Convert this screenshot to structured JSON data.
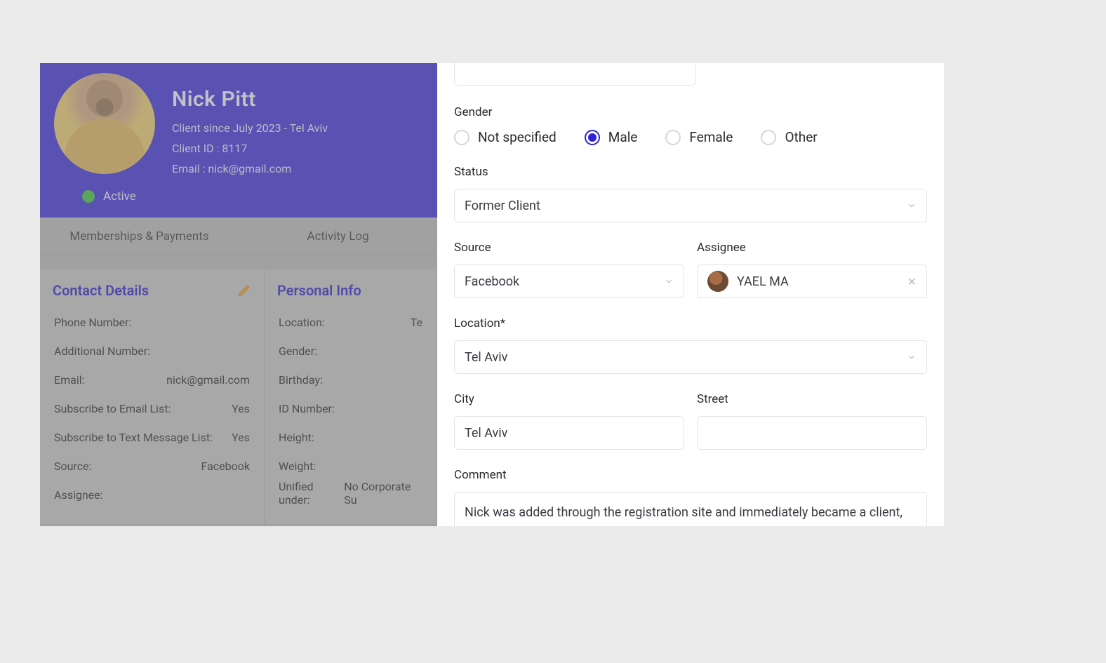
{
  "header": {
    "name": "Nick Pitt",
    "since_line": "Client since July 2023 - Tel Aviv",
    "client_id_line": "Client ID : 8117",
    "email_line": "Email : nick@gmail.com",
    "status": "Active"
  },
  "tabs": {
    "memberships": "Memberships & Payments",
    "activity": "Activity Log"
  },
  "contact": {
    "title": "Contact Details",
    "phone_k": "Phone Number:",
    "addl_k": "Additional Number:",
    "email_k": "Email:",
    "email_v": "nick@gmail.com",
    "sub_email_k": "Subscribe to Email List:",
    "sub_email_v": "Yes",
    "sub_text_k": "Subscribe to Text Message List:",
    "sub_text_v": "Yes",
    "source_k": "Source:",
    "source_v": "Facebook",
    "assignee_k": "Assignee:"
  },
  "personal": {
    "title": "Personal Info",
    "location_k": "Location:",
    "location_v_partial": "Te",
    "gender_k": "Gender:",
    "birthday_k": "Birthday:",
    "idnum_k": "ID Number:",
    "height_k": "Height:",
    "weight_k": "Weight:",
    "unified_k": "Unified under:",
    "unified_v_partial": "No Corporate Su"
  },
  "form": {
    "gender_label": "Gender",
    "gender_opts": {
      "not_specified": "Not specified",
      "male": "Male",
      "female": "Female",
      "other": "Other"
    },
    "status_label": "Status",
    "status_value": "Former Client",
    "source_label": "Source",
    "source_value": "Facebook",
    "assignee_label": "Assignee",
    "assignee_value": "YAEL MA",
    "location_label": "Location*",
    "location_value": "Tel Aviv",
    "city_label": "City",
    "city_value": "Tel Aviv",
    "street_label": "Street",
    "comment_label": "Comment",
    "comment_value": "Nick was added through the registration site and immediately became a client, so I converted him back to a lead and signed him up for a trial session."
  }
}
